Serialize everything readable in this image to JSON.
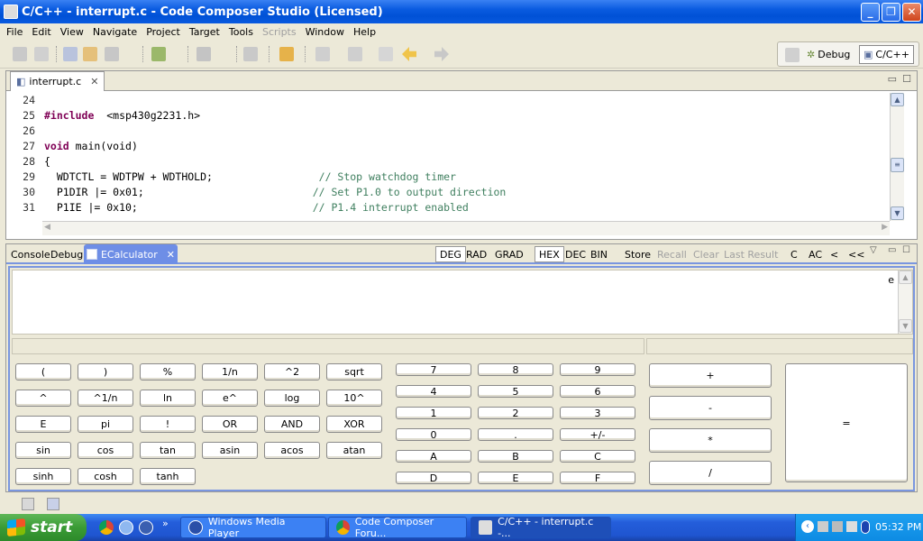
{
  "window": {
    "title": "C/C++ - interrupt.c - Code Composer Studio (Licensed)"
  },
  "menu": [
    "File",
    "Edit",
    "View",
    "Navigate",
    "Project",
    "Target",
    "Tools",
    "Scripts",
    "Window",
    "Help"
  ],
  "menu_disabled": [
    "Scripts"
  ],
  "perspectives": {
    "debug": "Debug",
    "cpp": "C/C++"
  },
  "editor": {
    "tab": "interrupt.c",
    "lines": [
      {
        "n": "24",
        "kw": "",
        "text": "",
        "cm": ""
      },
      {
        "n": "25",
        "kw": "#include",
        "text": "  <msp430g2231.h>",
        "cm": ""
      },
      {
        "n": "26",
        "kw": "",
        "text": "",
        "cm": ""
      },
      {
        "n": "27",
        "kw": "void",
        "text": " main(void)",
        "cm": ""
      },
      {
        "n": "28",
        "kw": "",
        "text": "{",
        "cm": ""
      },
      {
        "n": "29",
        "kw": "",
        "text": "  WDTCTL = WDTPW + WDTHOLD;                 ",
        "cm": "// Stop watchdog timer"
      },
      {
        "n": "30",
        "kw": "",
        "text": "  P1DIR |= 0x01;                           ",
        "cm": "// Set P1.0 to output direction"
      },
      {
        "n": "31",
        "kw": "",
        "text": "  P1IE |= 0x10;                            ",
        "cm": "// P1.4 interrupt enabled"
      }
    ]
  },
  "panel": {
    "tabs": [
      "Console",
      "Debug",
      "ECalculator"
    ],
    "modes": [
      "DEG",
      "RAD",
      "GRAD"
    ],
    "bases": [
      "HEX",
      "DEC",
      "BIN"
    ],
    "memory": [
      "Store",
      "Recall",
      "Clear",
      "Last Result"
    ],
    "clear": [
      "C",
      "AC",
      "<",
      "<<"
    ],
    "display_value": "e"
  },
  "keys": {
    "sci": [
      [
        "(",
        ")",
        "%",
        "1/n",
        "^2",
        "sqrt"
      ],
      [
        "^",
        "^1/n",
        "ln",
        "e^",
        "log",
        "10^"
      ],
      [
        "E",
        "pi",
        "!",
        "OR",
        "AND",
        "XOR"
      ],
      [
        "sin",
        "cos",
        "tan",
        "asin",
        "acos",
        "atan"
      ],
      [
        "sinh",
        "cosh",
        "tanh"
      ]
    ],
    "num": [
      [
        "7",
        "8",
        "9"
      ],
      [
        "4",
        "5",
        "6"
      ],
      [
        "1",
        "2",
        "3"
      ],
      [
        "0",
        ".",
        "+/-"
      ],
      [
        "A",
        "B",
        "C"
      ],
      [
        "D",
        "E",
        "F"
      ]
    ],
    "ops": [
      "+",
      "-",
      "*",
      "/"
    ],
    "equals": "="
  },
  "taskbar": {
    "start": "start",
    "tasks": [
      "Windows Media Player",
      "Code Composer Foru...",
      "C/C++ - interrupt.c -..."
    ],
    "time": "05:32 PM"
  },
  "colors": {
    "accent": "#0a5be0",
    "panel_border": "#7a96df",
    "keyword": "#7f0055",
    "comment": "#3f7f5f"
  }
}
